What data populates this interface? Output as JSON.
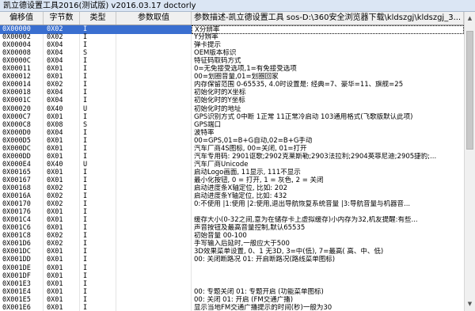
{
  "window": {
    "title": "凯立德设置工具2016(测试版) v2016.03.17 doctorly"
  },
  "columns": {
    "offset": "偏移值",
    "type": "字节数",
    "kind": "类型",
    "value": "参数取值",
    "desc": "参数描述-凯立德设置工具 sos-D:\\360安全浏览器下载\\kldszgj\\kldszgj_3..."
  },
  "rows": [
    {
      "offset": "0X00000",
      "type": "0X02",
      "kind": "I",
      "value": "",
      "desc": "X分辨率"
    },
    {
      "offset": "0X00002",
      "type": "0X02",
      "kind": "I",
      "value": "",
      "desc": "Y分辨率"
    },
    {
      "offset": "0X00004",
      "type": "0X04",
      "kind": "I",
      "value": "",
      "desc": "弹卡提示"
    },
    {
      "offset": "0X00008",
      "type": "0X04",
      "kind": "S",
      "value": "",
      "desc": "OEM版本标识"
    },
    {
      "offset": "0X0000C",
      "type": "0X04",
      "kind": "I",
      "value": "",
      "desc": "特征码取码方式"
    },
    {
      "offset": "0X00011",
      "type": "0X01",
      "kind": "I",
      "value": "",
      "desc": "0=无免接受选项,1=有免接受选项"
    },
    {
      "offset": "0X00012",
      "type": "0X01",
      "kind": "I",
      "value": "",
      "desc": "00=划圈音量,01=划圈回家"
    },
    {
      "offset": "0X00014",
      "type": "0X02",
      "kind": "I",
      "value": "",
      "desc": "内存保留范围 0-65535, 4.0时设置是: 经典=7、豪华=11、旗舰=25"
    },
    {
      "offset": "0X00018",
      "type": "0X04",
      "kind": "I",
      "value": "",
      "desc": "初始化时的X坐标"
    },
    {
      "offset": "0X0001C",
      "type": "0X04",
      "kind": "I",
      "value": "",
      "desc": "初始化时的Y坐标"
    },
    {
      "offset": "0X00020",
      "type": "0X40",
      "kind": "U",
      "value": "",
      "desc": "初始化时的地址"
    },
    {
      "offset": "0X000C7",
      "type": "0X01",
      "kind": "I",
      "value": "",
      "desc": "GPS识别方式 0中断 1正常 11正常冷启动 103通用格式(飞歌版默认此项)"
    },
    {
      "offset": "0X000C8",
      "type": "0X08",
      "kind": "S",
      "value": "",
      "desc": "GPS端口"
    },
    {
      "offset": "0X000D0",
      "type": "0X04",
      "kind": "I",
      "value": "",
      "desc": "波特率"
    },
    {
      "offset": "0X000D5",
      "type": "0X01",
      "kind": "I",
      "value": "",
      "desc": "00=GPS,01=B+G自动,02=B+G手动"
    },
    {
      "offset": "0X000DC",
      "type": "0X01",
      "kind": "I",
      "value": "",
      "desc": "汽车厂商4S图标, 00=关闭, 01=打开"
    },
    {
      "offset": "0X000DD",
      "type": "0X01",
      "kind": "I",
      "value": "",
      "desc": "汽车专用码: 2901讴歌;2902克莱斯勒;2903法拉利;2904英菲尼迪;2905捷豹;..."
    },
    {
      "offset": "0X000E4",
      "type": "0X40",
      "kind": "U",
      "value": "",
      "desc": "汽车厂商Unicode"
    },
    {
      "offset": "0X00165",
      "type": "0X01",
      "kind": "I",
      "value": "",
      "desc": "启动Logo画面, 11显示, 111不显示"
    },
    {
      "offset": "0X00167",
      "type": "0X01",
      "kind": "I",
      "value": "",
      "desc": "最小化按钮, 0 = 打开, 1 = 灰色, 2 = 关闭"
    },
    {
      "offset": "0X00168",
      "type": "0X02",
      "kind": "I",
      "value": "",
      "desc": "启动进度条X轴定位, 比如: 202"
    },
    {
      "offset": "0X0016A",
      "type": "0X02",
      "kind": "I",
      "value": "",
      "desc": "启动进度条Y轴定位, 比如: 432"
    },
    {
      "offset": "0X00170",
      "type": "0X02",
      "kind": "I",
      "value": "",
      "desc": "0:不使用 |1:使用 |2:使用,退出导航恢复系统音量 |3:导航音量与机器音..."
    },
    {
      "offset": "0X00176",
      "type": "0X01",
      "kind": "I",
      "value": "",
      "desc": ""
    },
    {
      "offset": "0X001C4",
      "type": "0X01",
      "kind": "I",
      "value": "",
      "desc": "缓存大小(0-32之间,意为在储存卡上虚拟缓存)小内存为32,机友提醒:有些..."
    },
    {
      "offset": "0X001C6",
      "type": "0X01",
      "kind": "I",
      "value": "",
      "desc": "声音按钮及最高音量控制,默认65535"
    },
    {
      "offset": "0X001C8",
      "type": "0X02",
      "kind": "I",
      "value": "",
      "desc": "初始音量 00-100"
    },
    {
      "offset": "0X001D6",
      "type": "0X02",
      "kind": "I",
      "value": "",
      "desc": "手写输入后延时,一般应大于500"
    },
    {
      "offset": "0X001DC",
      "type": "0X01",
      "kind": "I",
      "value": "",
      "desc": "3D效果菜单设置, 0、1 无3D, 3=中(低), 7=最高( 高、中、低)"
    },
    {
      "offset": "0X001DD",
      "type": "0X01",
      "kind": "I",
      "value": "",
      "desc": "00: 关闭断路况  01: 开启断路况(路线菜单图标)"
    },
    {
      "offset": "0X001DE",
      "type": "0X01",
      "kind": "I",
      "value": "",
      "desc": ""
    },
    {
      "offset": "0X001DF",
      "type": "0X01",
      "kind": "I",
      "value": "",
      "desc": ""
    },
    {
      "offset": "0X001E3",
      "type": "0X01",
      "kind": "I",
      "value": "",
      "desc": ""
    },
    {
      "offset": "0X001E4",
      "type": "0X01",
      "kind": "I",
      "value": "",
      "desc": "00: 专题关闭  01: 专题开启  (功能菜单图标)"
    },
    {
      "offset": "0X001E5",
      "type": "0X01",
      "kind": "I",
      "value": "",
      "desc": "00: 关闭  01: 开启  (FM交通广播)"
    },
    {
      "offset": "0X001E6",
      "type": "0X01",
      "kind": "I",
      "value": "",
      "desc": "显示当地FM交通广播提示的时间(秒)一般为30"
    }
  ],
  "scrollbar": {
    "up_icon": "scroll-up-arrow-icon",
    "down_icon": "scroll-down-arrow-icon"
  }
}
